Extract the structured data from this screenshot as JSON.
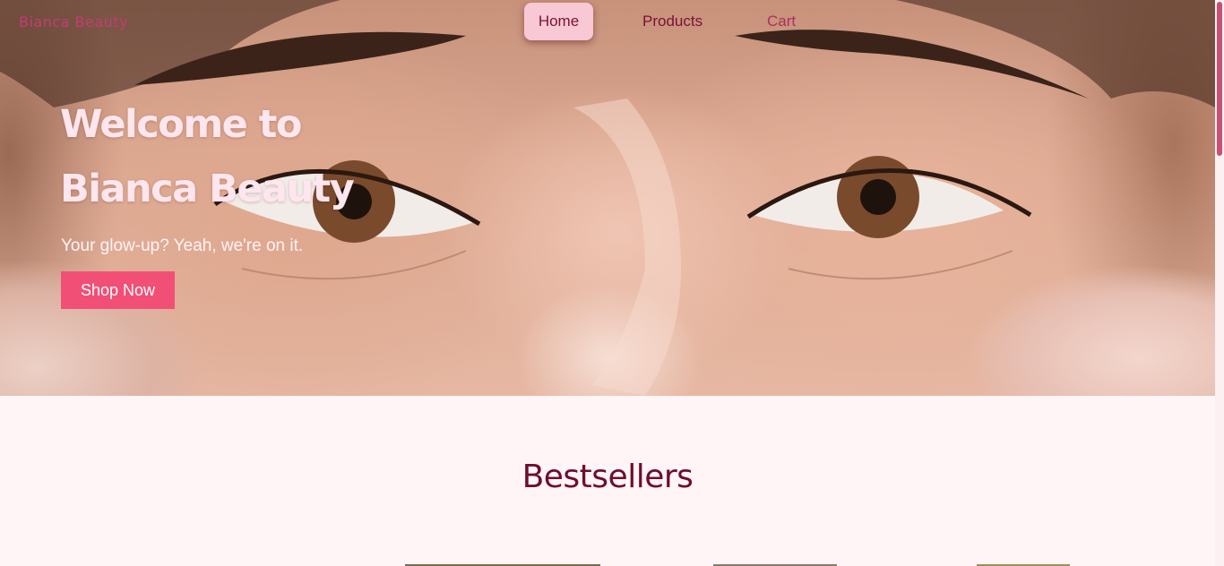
{
  "nav": {
    "brand": "Bianca Beauty",
    "links": [
      {
        "label": "Home",
        "active": true
      },
      {
        "label": "Products",
        "active": false
      },
      {
        "label": "Cart",
        "active": false
      }
    ]
  },
  "hero": {
    "title_line1": "Welcome to",
    "title_line2": "Bianca Beauty",
    "subtitle": "Your glow-up? Yeah, we're on it.",
    "cta_label": "Shop Now",
    "background_image": "close-up-face-eyes-photo"
  },
  "bestsellers": {
    "title": "Bestsellers"
  },
  "colors": {
    "accent": "#f24f76",
    "nav_active_bg": "#f8c8d4",
    "heading": "#6e0d30",
    "page_bg": "#fff5f6",
    "brand": "#c33c73"
  }
}
